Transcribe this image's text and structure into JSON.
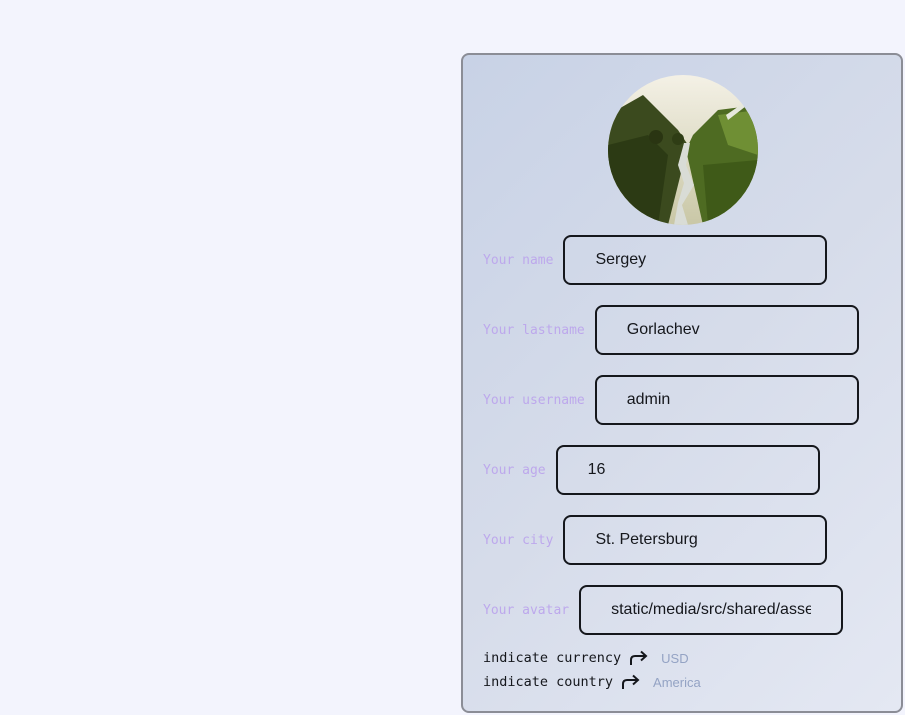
{
  "profile": {
    "avatar_image": "landscape-valley-stream",
    "fields": [
      {
        "label": "Your name",
        "value": "Sergey"
      },
      {
        "label": "Your lastname",
        "value": "Gorlachev"
      },
      {
        "label": "Your username",
        "value": "admin"
      },
      {
        "label": "Your age",
        "value": "16"
      },
      {
        "label": "Your city",
        "value": "St. Petersburg"
      },
      {
        "label": "Your avatar",
        "value": "static/media/src/shared/assets/images/avatar.jpg"
      }
    ],
    "currency": {
      "label": "indicate currency",
      "value": "USD",
      "icon": "redo-arrow-icon"
    },
    "country": {
      "label": "indicate country",
      "value": "America",
      "icon": "redo-arrow-icon"
    }
  },
  "colors": {
    "background": "#f3f4fd",
    "label": "#bda8ec",
    "border": "#15171c",
    "muted_value": "#94a3c4"
  }
}
